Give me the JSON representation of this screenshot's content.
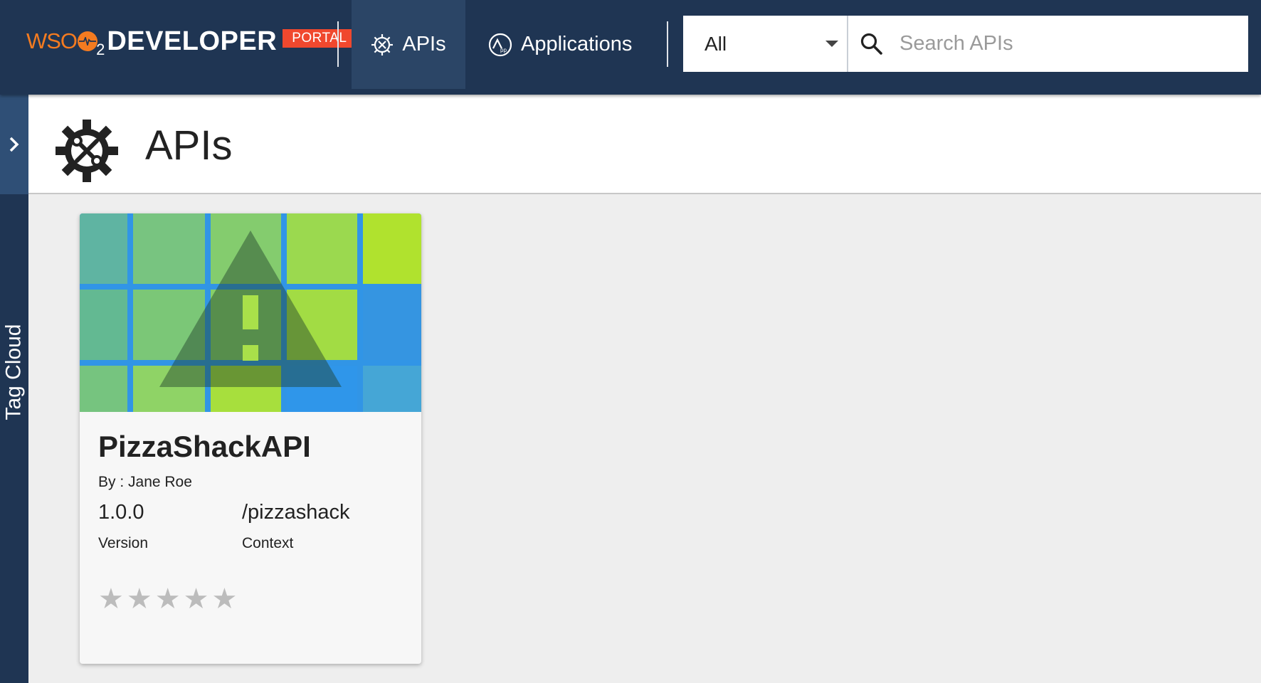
{
  "header": {
    "logo": {
      "brand": "WSO",
      "brand_sub": "2",
      "product": "DEVELOPER",
      "badge": "PORTAL"
    },
    "nav": [
      {
        "label": "APIs",
        "icon": "gear-wrench-icon",
        "active": true
      },
      {
        "label": "Applications",
        "icon": "applications-icon",
        "active": false
      }
    ],
    "search": {
      "filter_value": "All",
      "placeholder": "Search APIs"
    }
  },
  "sidebar": {
    "tag_cloud_label": "Tag Cloud",
    "toggle_icon": "chevron-right-icon"
  },
  "page": {
    "title": "APIs",
    "title_icon": "gear-wrench-icon"
  },
  "apis": [
    {
      "name": "PizzaShackAPI",
      "author": "By : Jane Roe",
      "version": "1.0.0",
      "version_label": "Version",
      "context": "/pizzashack",
      "context_label": "Context",
      "rating": 0,
      "rating_max": 5,
      "thumbnail_icon": "warning-icon"
    }
  ],
  "colors": {
    "header": "#1f3553",
    "active_nav": "#2b4566",
    "brand_orange": "#f47b20",
    "portal_badge": "#f0482e"
  }
}
